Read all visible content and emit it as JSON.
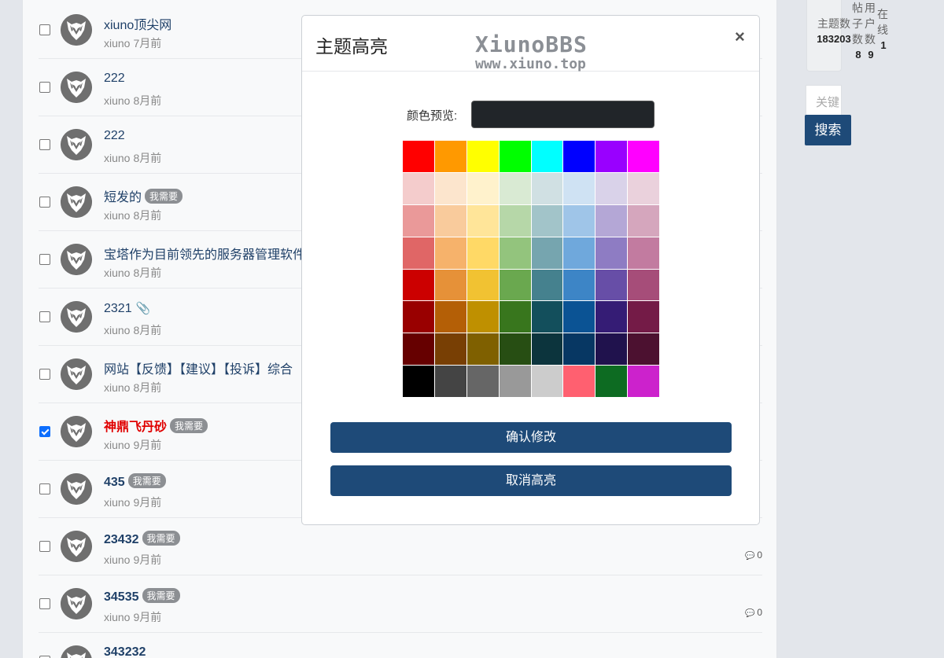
{
  "threads": [
    {
      "title": "xiuno顶尖网",
      "style": "normal",
      "badge": "",
      "attachment": false,
      "user": "xiuno",
      "time": "7月前",
      "replies": "",
      "checked": false
    },
    {
      "title": "222",
      "style": "normal",
      "badge": "",
      "attachment": false,
      "user": "xiuno",
      "time": "8月前",
      "replies": "",
      "checked": false
    },
    {
      "title": "222",
      "style": "normal",
      "badge": "",
      "attachment": false,
      "user": "xiuno",
      "time": "8月前",
      "replies": "",
      "checked": false
    },
    {
      "title": "短发的",
      "style": "normal",
      "badge": "我需要",
      "attachment": false,
      "user": "xiuno",
      "time": "8月前",
      "replies": "",
      "checked": false
    },
    {
      "title": "宝塔作为目前领先的服务器管理软件",
      "style": "normal",
      "badge": "",
      "attachment": false,
      "user": "xiuno",
      "time": "8月前",
      "replies": "",
      "checked": false
    },
    {
      "title": "2321",
      "style": "normal",
      "badge": "",
      "attachment": true,
      "user": "xiuno",
      "time": "8月前",
      "replies": "",
      "checked": false
    },
    {
      "title": "网站【反馈】【建议】【投诉】综合",
      "style": "normal",
      "badge": "",
      "attachment": false,
      "user": "xiuno",
      "time": "8月前",
      "replies": "",
      "checked": false
    },
    {
      "title": "神鼎飞丹砂",
      "style": "red",
      "badge": "我需要",
      "attachment": false,
      "user": "xiuno",
      "time": "9月前",
      "replies": "",
      "checked": true
    },
    {
      "title": "435",
      "style": "bold",
      "badge": "我需要",
      "attachment": false,
      "user": "xiuno",
      "time": "9月前",
      "replies": "",
      "checked": false
    },
    {
      "title": "23432",
      "style": "bold",
      "badge": "我需要",
      "attachment": false,
      "user": "xiuno",
      "time": "9月前",
      "replies": "0",
      "checked": false
    },
    {
      "title": "34535",
      "style": "bold",
      "badge": "我需要",
      "attachment": false,
      "user": "xiuno",
      "time": "9月前",
      "replies": "0",
      "checked": false
    },
    {
      "title": "343232",
      "style": "bold",
      "badge": "",
      "attachment": false,
      "user": "",
      "time": "",
      "replies": "",
      "checked": false
    }
  ],
  "sidebar": {
    "stats": [
      {
        "label": "主题数",
        "value": "183203"
      },
      {
        "label": "帖子数",
        "value": "8"
      },
      {
        "label": "用户数",
        "value": "9"
      },
      {
        "label": "在线",
        "value": "1"
      }
    ],
    "search_placeholder": "关键",
    "search_button": "搜索"
  },
  "modal": {
    "title": "主题高亮",
    "close": "×",
    "watermark_line1": "XiunoBBS",
    "watermark_line2": "www.xiuno.top",
    "preview_label": "颜色预览:",
    "preview_color": "#212529",
    "confirm": "确认修改",
    "cancel": "取消高亮",
    "palette": [
      "#ff0000",
      "#ff9900",
      "#ffff00",
      "#00ff00",
      "#00ffff",
      "#0000ff",
      "#9900ff",
      "#ff00ff",
      "#f4cccc",
      "#fce5cd",
      "#fff2cc",
      "#d9ead3",
      "#d0e0e3",
      "#cfe2f3",
      "#d9d2e9",
      "#ead1dc",
      "#ea9999",
      "#f9cb9c",
      "#ffe599",
      "#b6d7a8",
      "#a2c4c9",
      "#9fc5e8",
      "#b4a7d6",
      "#d5a6bd",
      "#e06666",
      "#f6b26b",
      "#ffd966",
      "#93c47d",
      "#76a5af",
      "#6fa8dc",
      "#8e7cc3",
      "#c27ba0",
      "#cc0000",
      "#e69138",
      "#f1c232",
      "#6aa84f",
      "#45818e",
      "#3d85c6",
      "#674ea7",
      "#a64d79",
      "#990000",
      "#b45f06",
      "#bf9000",
      "#38761d",
      "#134f5c",
      "#0b5394",
      "#351c75",
      "#741b47",
      "#660000",
      "#783f04",
      "#7f6000",
      "#274e13",
      "#0c343d",
      "#073763",
      "#20124d",
      "#4c1130",
      "#000000",
      "#444444",
      "#666666",
      "#999999",
      "#cccccc",
      "#ff6070",
      "#0d6b22",
      "#cc22cc"
    ]
  },
  "colors": {
    "primary": "#1e4a78",
    "link": "#1f4068",
    "highlight_red": "#e00000"
  }
}
